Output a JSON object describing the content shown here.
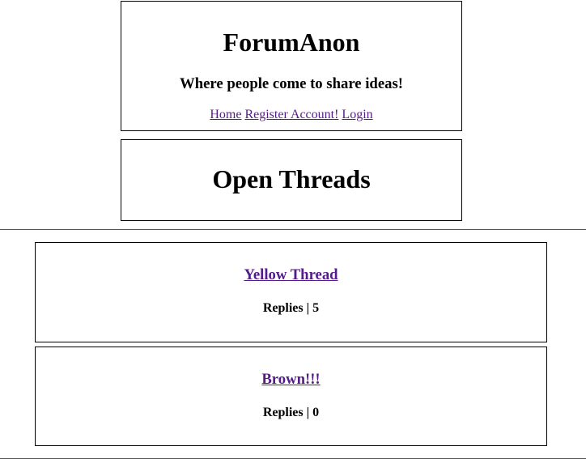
{
  "site": {
    "title": "ForumAnon",
    "tagline": "Where people come to share ideas!"
  },
  "nav": {
    "items": [
      {
        "label": "Home"
      },
      {
        "label": "Register Account!"
      },
      {
        "label": "Login"
      }
    ]
  },
  "section_heading": "Open Threads",
  "threads": [
    {
      "title": "Yellow Thread",
      "replies_label": "Replies",
      "separator": "|",
      "replies": "5"
    },
    {
      "title": "Brown!!!",
      "replies_label": "Replies",
      "separator": "|",
      "replies": "0"
    }
  ],
  "colors": {
    "link_visited": "#551a8b",
    "border": "#000000"
  }
}
